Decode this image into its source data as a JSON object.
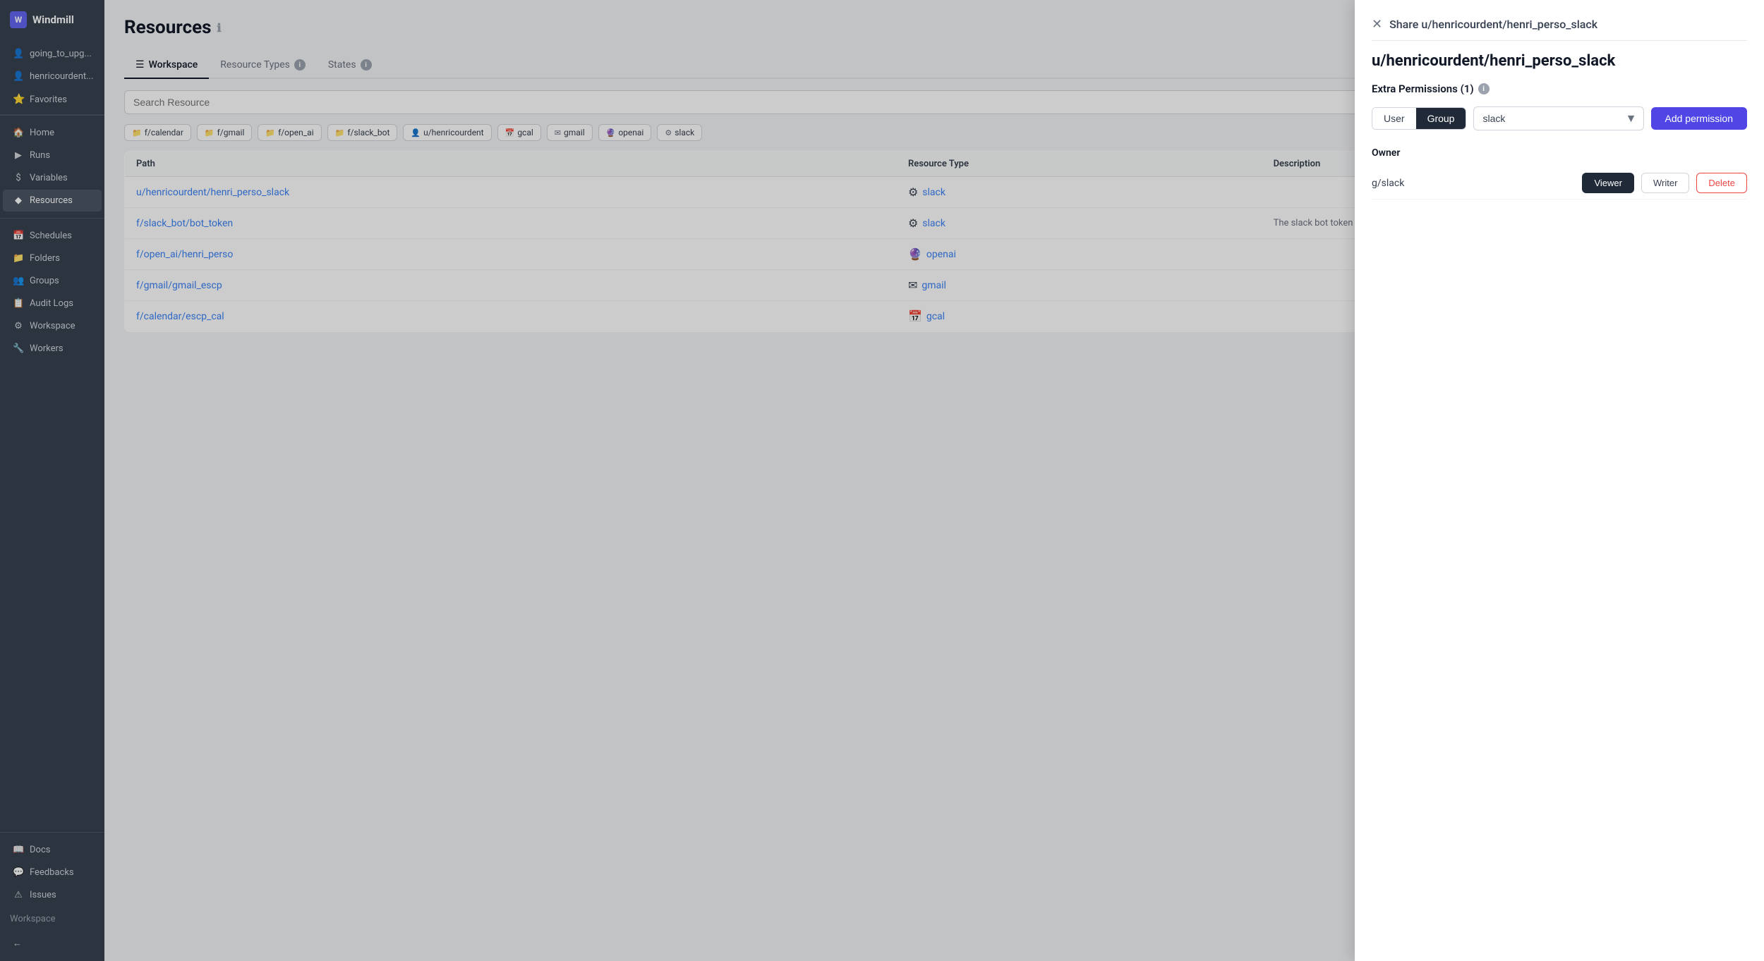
{
  "app": {
    "name": "Windmill"
  },
  "sidebar": {
    "logo": "W",
    "username": "going_to_upg...",
    "user_short": "henricourdent...",
    "favorites_label": "Favorites",
    "nav_items": [
      {
        "id": "home",
        "label": "Home",
        "icon": "🏠"
      },
      {
        "id": "runs",
        "label": "Runs",
        "icon": "▶"
      },
      {
        "id": "variables",
        "label": "Variables",
        "icon": "$"
      },
      {
        "id": "resources",
        "label": "Resources",
        "icon": "◆",
        "active": true
      }
    ],
    "bottom_items": [
      {
        "id": "schedules",
        "label": "Schedules",
        "icon": "📅"
      },
      {
        "id": "folders",
        "label": "Folders",
        "icon": "📁"
      },
      {
        "id": "groups",
        "label": "Groups",
        "icon": "👥"
      },
      {
        "id": "audit-logs",
        "label": "Audit Logs",
        "icon": "📋"
      },
      {
        "id": "workspace",
        "label": "Workspace",
        "icon": "⚙"
      },
      {
        "id": "workers",
        "label": "Workers",
        "icon": "🔧"
      }
    ],
    "footer_items": [
      {
        "id": "docs",
        "label": "Docs",
        "icon": "📖"
      },
      {
        "id": "feedbacks",
        "label": "Feedbacks",
        "icon": "💬"
      },
      {
        "id": "issues",
        "label": "Issues",
        "icon": "⚠"
      }
    ],
    "workspace_label": "Workspace",
    "back_icon": "←"
  },
  "main": {
    "page_title": "Resources",
    "tabs": [
      {
        "id": "workspace",
        "label": "Workspace",
        "icon": "☰",
        "active": true
      },
      {
        "id": "resource-types",
        "label": "Resource Types",
        "icon": "ℹ"
      },
      {
        "id": "states",
        "label": "States",
        "icon": "ℹ"
      }
    ],
    "search_placeholder": "Search Resource",
    "filters": [
      {
        "id": "f-calendar",
        "label": "f/calendar",
        "icon": "📁"
      },
      {
        "id": "f-gmail",
        "label": "f/gmail",
        "icon": "📁"
      },
      {
        "id": "f-open-ai",
        "label": "f/open_ai",
        "icon": "📁"
      },
      {
        "id": "f-slack-bot",
        "label": "f/slack_bot",
        "icon": "📁"
      },
      {
        "id": "u-henricourdent",
        "label": "u/henricourdent",
        "icon": "👤"
      },
      {
        "id": "gcal",
        "label": "gcal",
        "icon": "📅"
      },
      {
        "id": "gmail",
        "label": "gmail",
        "icon": "✉"
      },
      {
        "id": "openai",
        "label": "openai",
        "icon": "🔮"
      },
      {
        "id": "slack",
        "label": "slack",
        "icon": "⚙"
      }
    ],
    "table": {
      "columns": [
        "Path",
        "Resource Type",
        "Description"
      ],
      "rows": [
        {
          "path": "u/henricourdent/henri_perso_slack",
          "path_url": "#",
          "resource_type": "slack",
          "resource_type_icon": "⚙",
          "description": ""
        },
        {
          "path": "f/slack_bot/bot_token",
          "path_url": "#",
          "resource_type": "slack",
          "resource_type_icon": "⚙",
          "description": "The slack bot token n"
        },
        {
          "path": "f/open_ai/henri_perso",
          "path_url": "#",
          "resource_type": "openai",
          "resource_type_icon": "🔮",
          "description": ""
        },
        {
          "path": "f/gmail/gmail_escp",
          "path_url": "#",
          "resource_type": "gmail",
          "resource_type_icon": "✉",
          "description": ""
        },
        {
          "path": "f/calendar/escp_cal",
          "path_url": "#",
          "resource_type": "gcal",
          "resource_type_icon": "📅",
          "description": ""
        }
      ]
    }
  },
  "panel": {
    "close_label": "✕",
    "header_title": "Share u/henricourdent/henri_perso_slack",
    "resource_title": "u/henricourdent/henri_perso_slack",
    "extra_permissions_label": "Extra Permissions (1)",
    "user_toggle": "User",
    "group_toggle": "Group",
    "selected_toggle": "Group",
    "dropdown_value": "slack",
    "dropdown_placeholder": "slack",
    "add_permission_label": "Add permission",
    "owner_label": "Owner",
    "permissions": [
      {
        "name": "g/slack",
        "viewer_label": "Viewer",
        "viewer_active": true,
        "writer_label": "Writer",
        "delete_label": "Delete"
      }
    ]
  }
}
